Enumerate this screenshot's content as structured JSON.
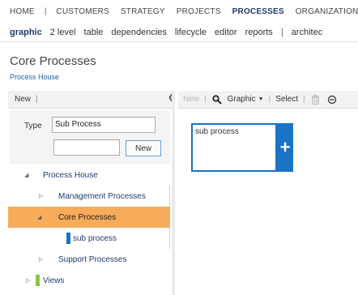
{
  "topnav": {
    "items": [
      "HOME",
      "CUSTOMERS",
      "STRATEGY",
      "PROJECTS",
      "PROCESSES",
      "ORGANIZATION"
    ],
    "active": "PROCESSES"
  },
  "subnav": {
    "items": [
      "graphic",
      "2 level",
      "table",
      "dependencies",
      "lifecycle",
      "editor",
      "reports",
      "architec"
    ],
    "active": "graphic"
  },
  "page": {
    "title": "Core Processes",
    "breadcrumb": "Process House"
  },
  "left_toolbar": {
    "new_label": "New"
  },
  "form": {
    "type_label": "Type",
    "type_value": "Sub Process",
    "blank_value": "",
    "new_button": "New"
  },
  "tree": {
    "root": "Process House",
    "management": "Management Processes",
    "core": "Core Processes",
    "sub": "sub process",
    "support": "Support Processes",
    "views": "Views"
  },
  "right_toolbar": {
    "new_label": "New",
    "graphic_label": "Graphic",
    "select_label": "Select"
  },
  "canvas": {
    "shape_text": "sub process",
    "add_symbol": "+"
  },
  "colors": {
    "accent": "#1a73c4",
    "selected": "#f7ac5b",
    "views_marker": "#8cc63f"
  }
}
